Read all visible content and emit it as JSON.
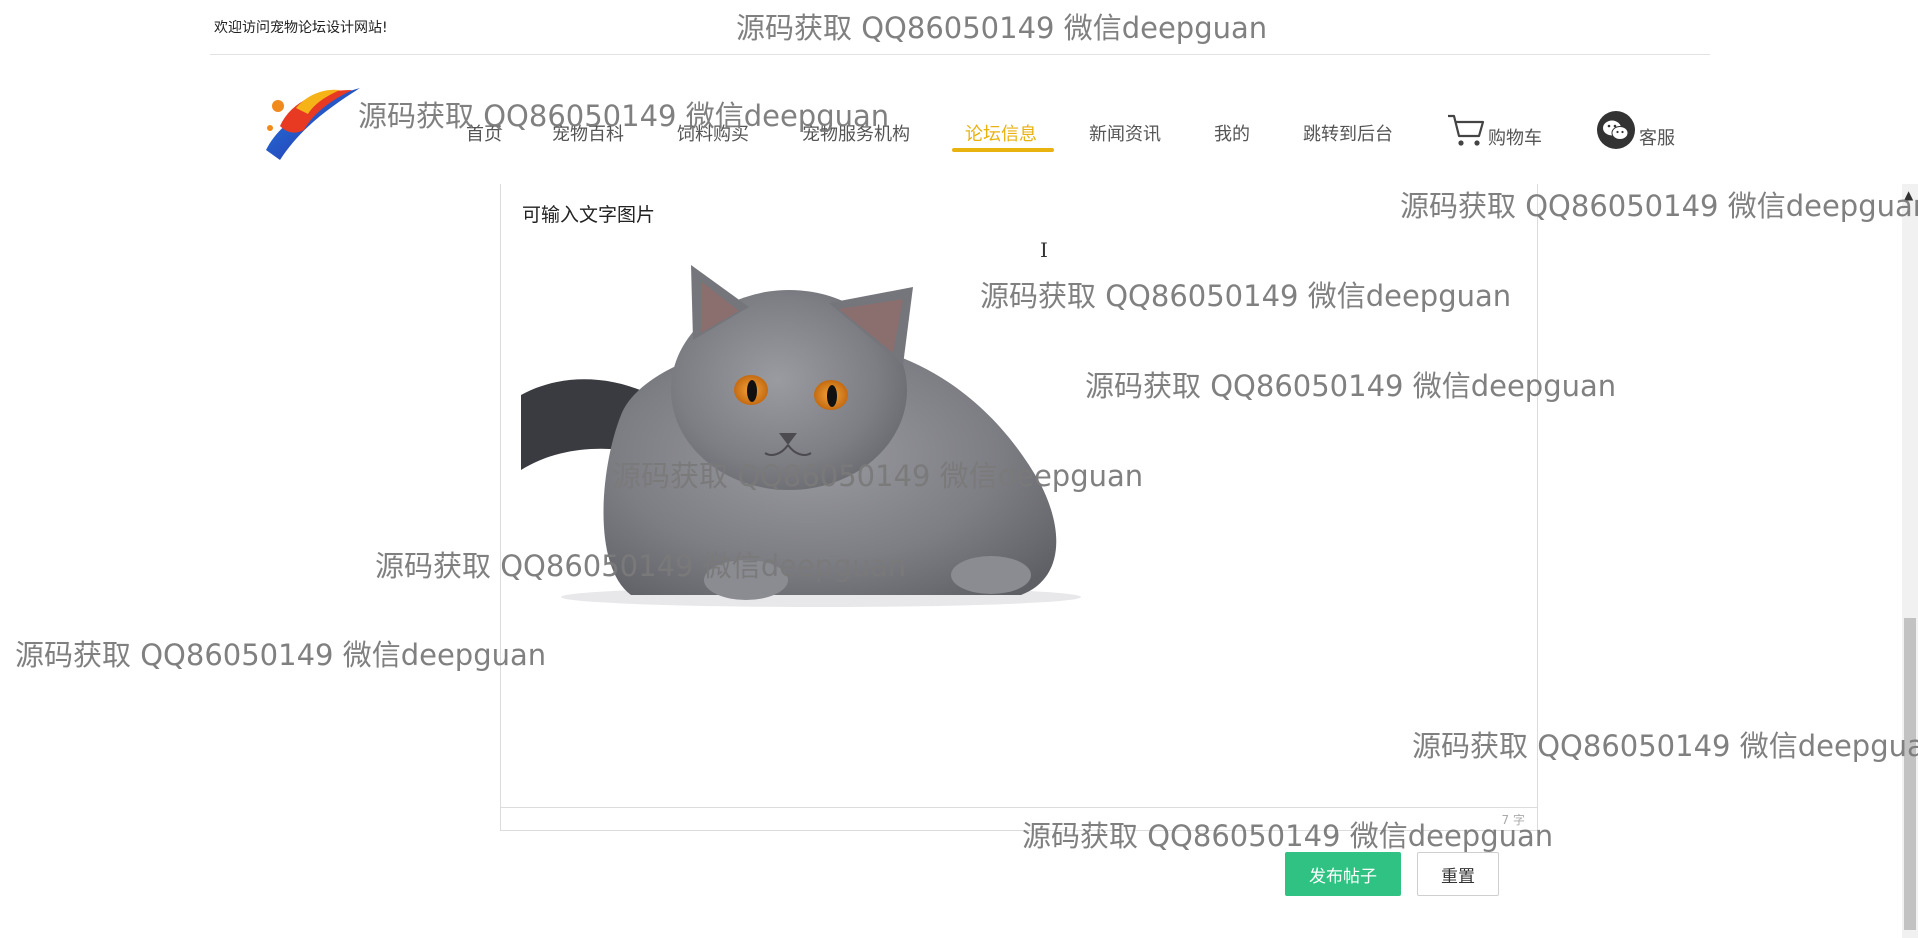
{
  "header": {
    "welcome": "欢迎访问宠物论坛设计网站!"
  },
  "nav": {
    "items": [
      {
        "label": "首页"
      },
      {
        "label": "宠物百科"
      },
      {
        "label": "饲料购买"
      },
      {
        "label": "宠物服务机构"
      },
      {
        "label": "论坛信息"
      },
      {
        "label": "新闻资讯"
      },
      {
        "label": "我的"
      },
      {
        "label": "跳转到后台"
      }
    ],
    "active_index": 4,
    "cart_label": "购物车",
    "service_label": "客服"
  },
  "editor": {
    "content_text": "可输入文字图片",
    "char_count": "7 字",
    "image_subject": "gray cat photo"
  },
  "actions": {
    "publish_label": "发布帖子",
    "reset_label": "重置"
  },
  "watermark": {
    "text": "源码获取 QQ86050149 微信deepguan"
  },
  "colors": {
    "accent": "#e8b20f",
    "publish": "#2fc282"
  }
}
